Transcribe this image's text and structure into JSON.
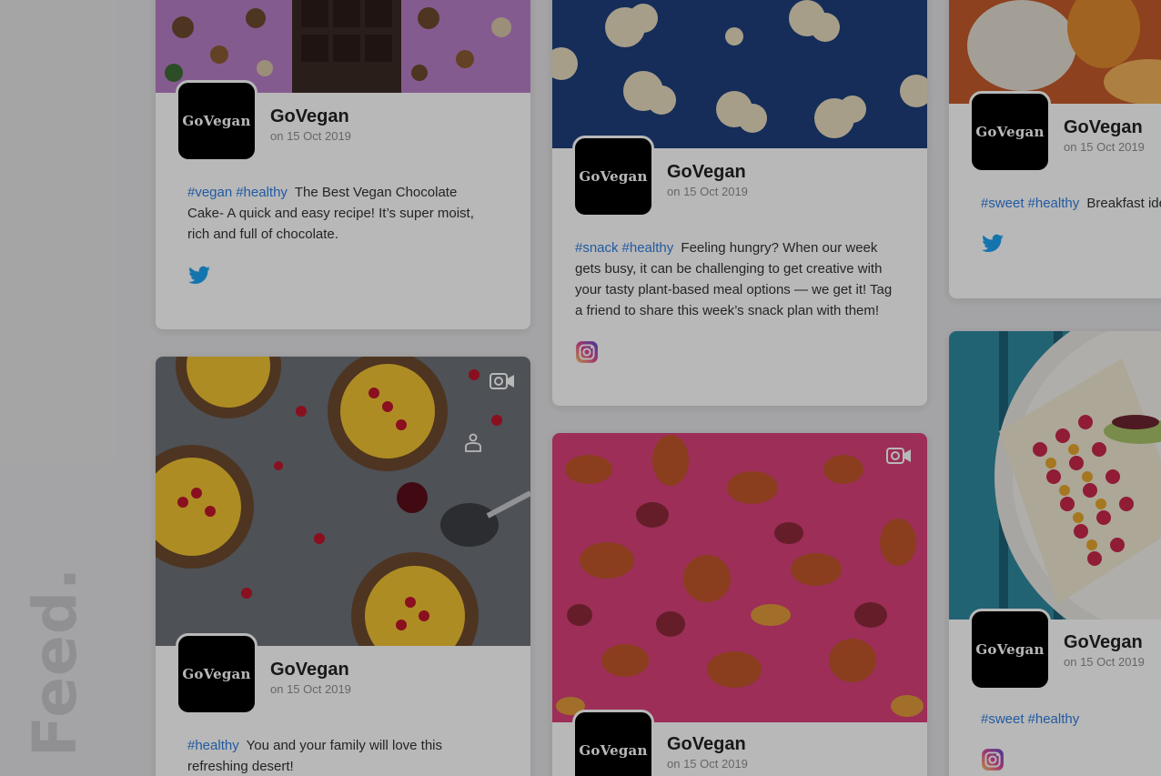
{
  "page": {
    "side_title": "Feed."
  },
  "colors": {
    "hashtag": "#2f7de1",
    "twitter": "#1da1f2",
    "overlay": "rgba(0,0,0,0.28)"
  },
  "posts": [
    {
      "author": "GoVegan",
      "avatar_text": "GoVegan",
      "date": "on 15 Oct 2019",
      "tags": [
        "#vegan",
        "#healthy"
      ],
      "text": "The Best Vegan Chocolate Cake- A quick and easy recipe! It’s super moist, rich and full of chocolate.",
      "source": "twitter-icon"
    },
    {
      "author": "GoVegan",
      "avatar_text": "GoVegan",
      "date": "on 15 Oct 2019",
      "tags": [
        "#snack",
        "#healthy"
      ],
      "text": "Feeling hungry? When our week gets busy, it can be challenging to get creative with your tasty plant-based meal options — we get it! Tag a friend to share this week’s snack plan with them!",
      "source": "instagram-icon"
    },
    {
      "author": "GoVegan",
      "avatar_text": "GoVegan",
      "date": "on 15 Oct 2019",
      "tags": [
        "#sweet",
        "#healthy"
      ],
      "text": "Breakfast ide",
      "source": "twitter-icon"
    },
    {
      "author": "GoVegan",
      "avatar_text": "GoVegan",
      "date": "on 15 Oct 2019",
      "tags": [
        "#healthy"
      ],
      "text": "You and your family will love this refreshing desert!",
      "source": "video-icon"
    },
    {
      "author": "GoVegan",
      "avatar_text": "GoVegan",
      "date": "on 15 Oct 2019",
      "tags": [],
      "text": "",
      "source": "video-icon"
    },
    {
      "author": "GoVegan",
      "avatar_text": "GoVegan",
      "date": "on 15 Oct 2019",
      "tags": [
        "#sweet",
        "#healthy"
      ],
      "text": "",
      "source": "instagram-icon"
    }
  ]
}
